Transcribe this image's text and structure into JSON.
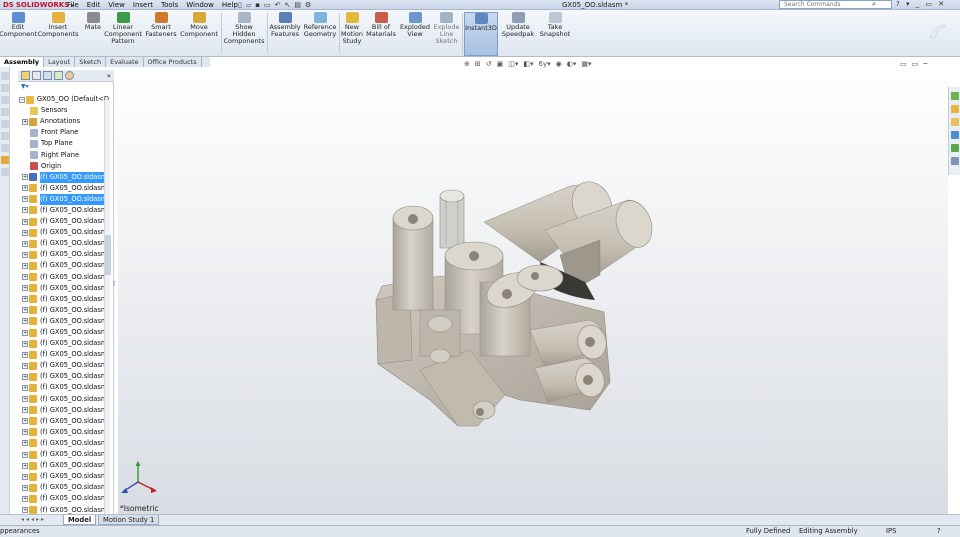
{
  "titlebar": {
    "logo_ds": "DS",
    "logo_text": "SOLIDWORKS",
    "menus": [
      "File",
      "Edit",
      "View",
      "Insert",
      "Tools",
      "Window",
      "Help"
    ],
    "document_title": "GX05_OO.sldasm *",
    "search_placeholder": "Search Commands"
  },
  "ribbon": {
    "buttons": [
      {
        "label": "Edit Component",
        "icon": "edit-component-icon"
      },
      {
        "label": "Insert Components",
        "icon": "insert-components-icon"
      },
      {
        "label": "Mate",
        "icon": "mate-icon"
      },
      {
        "label": "Linear Component Pattern",
        "icon": "linear-pattern-icon"
      },
      {
        "label": "Smart Fasteners",
        "icon": "smart-fasteners-icon"
      },
      {
        "label": "Move Component",
        "icon": "move-component-icon"
      },
      {
        "label": "Show Hidden Components",
        "icon": "show-hidden-icon"
      },
      {
        "label": "Assembly Features",
        "icon": "assembly-features-icon"
      },
      {
        "label": "Reference Geometry",
        "icon": "reference-geometry-icon"
      },
      {
        "label": "New Motion Study",
        "icon": "motion-study-icon"
      },
      {
        "label": "Bill of Materials",
        "icon": "bom-icon"
      },
      {
        "label": "Exploded View",
        "icon": "exploded-view-icon"
      },
      {
        "label": "Explode Line Sketch",
        "icon": "explode-line-icon"
      },
      {
        "label": "Instant3D",
        "icon": "instant3d-icon"
      },
      {
        "label": "Update Speedpak",
        "icon": "speedpak-icon"
      },
      {
        "label": "Take Snapshot",
        "icon": "snapshot-icon"
      }
    ]
  },
  "command_tabs": [
    "Assembly",
    "Layout",
    "Sketch",
    "Evaluate",
    "Office Products"
  ],
  "tree": {
    "root": "GX05_OO  (Default<D",
    "fixed_items": [
      "Sensors",
      "Annotations",
      "Front Plane",
      "Top Plane",
      "Right Plane",
      "Origin"
    ],
    "component_label": "(f) GX05_OO.sldasm",
    "component_count": 31,
    "selected_indices": [
      0,
      2
    ]
  },
  "bottom_tabs": [
    "Model",
    "Motion Study 1"
  ],
  "status": {
    "left": "ppearances",
    "fully_defined": "Fully Defined",
    "editing": "Editing Assembly",
    "units": "IPS",
    "help": "?"
  },
  "viewport": {
    "view_name": "*Isometric",
    "background_top": "#ffffff",
    "background_bottom": "#d9dde3",
    "model_color": "#c9c4ba"
  },
  "colors": {
    "selection": "#3399ff",
    "ribbon_bg": "#e8eef6",
    "brand_red": "#c8102e"
  }
}
